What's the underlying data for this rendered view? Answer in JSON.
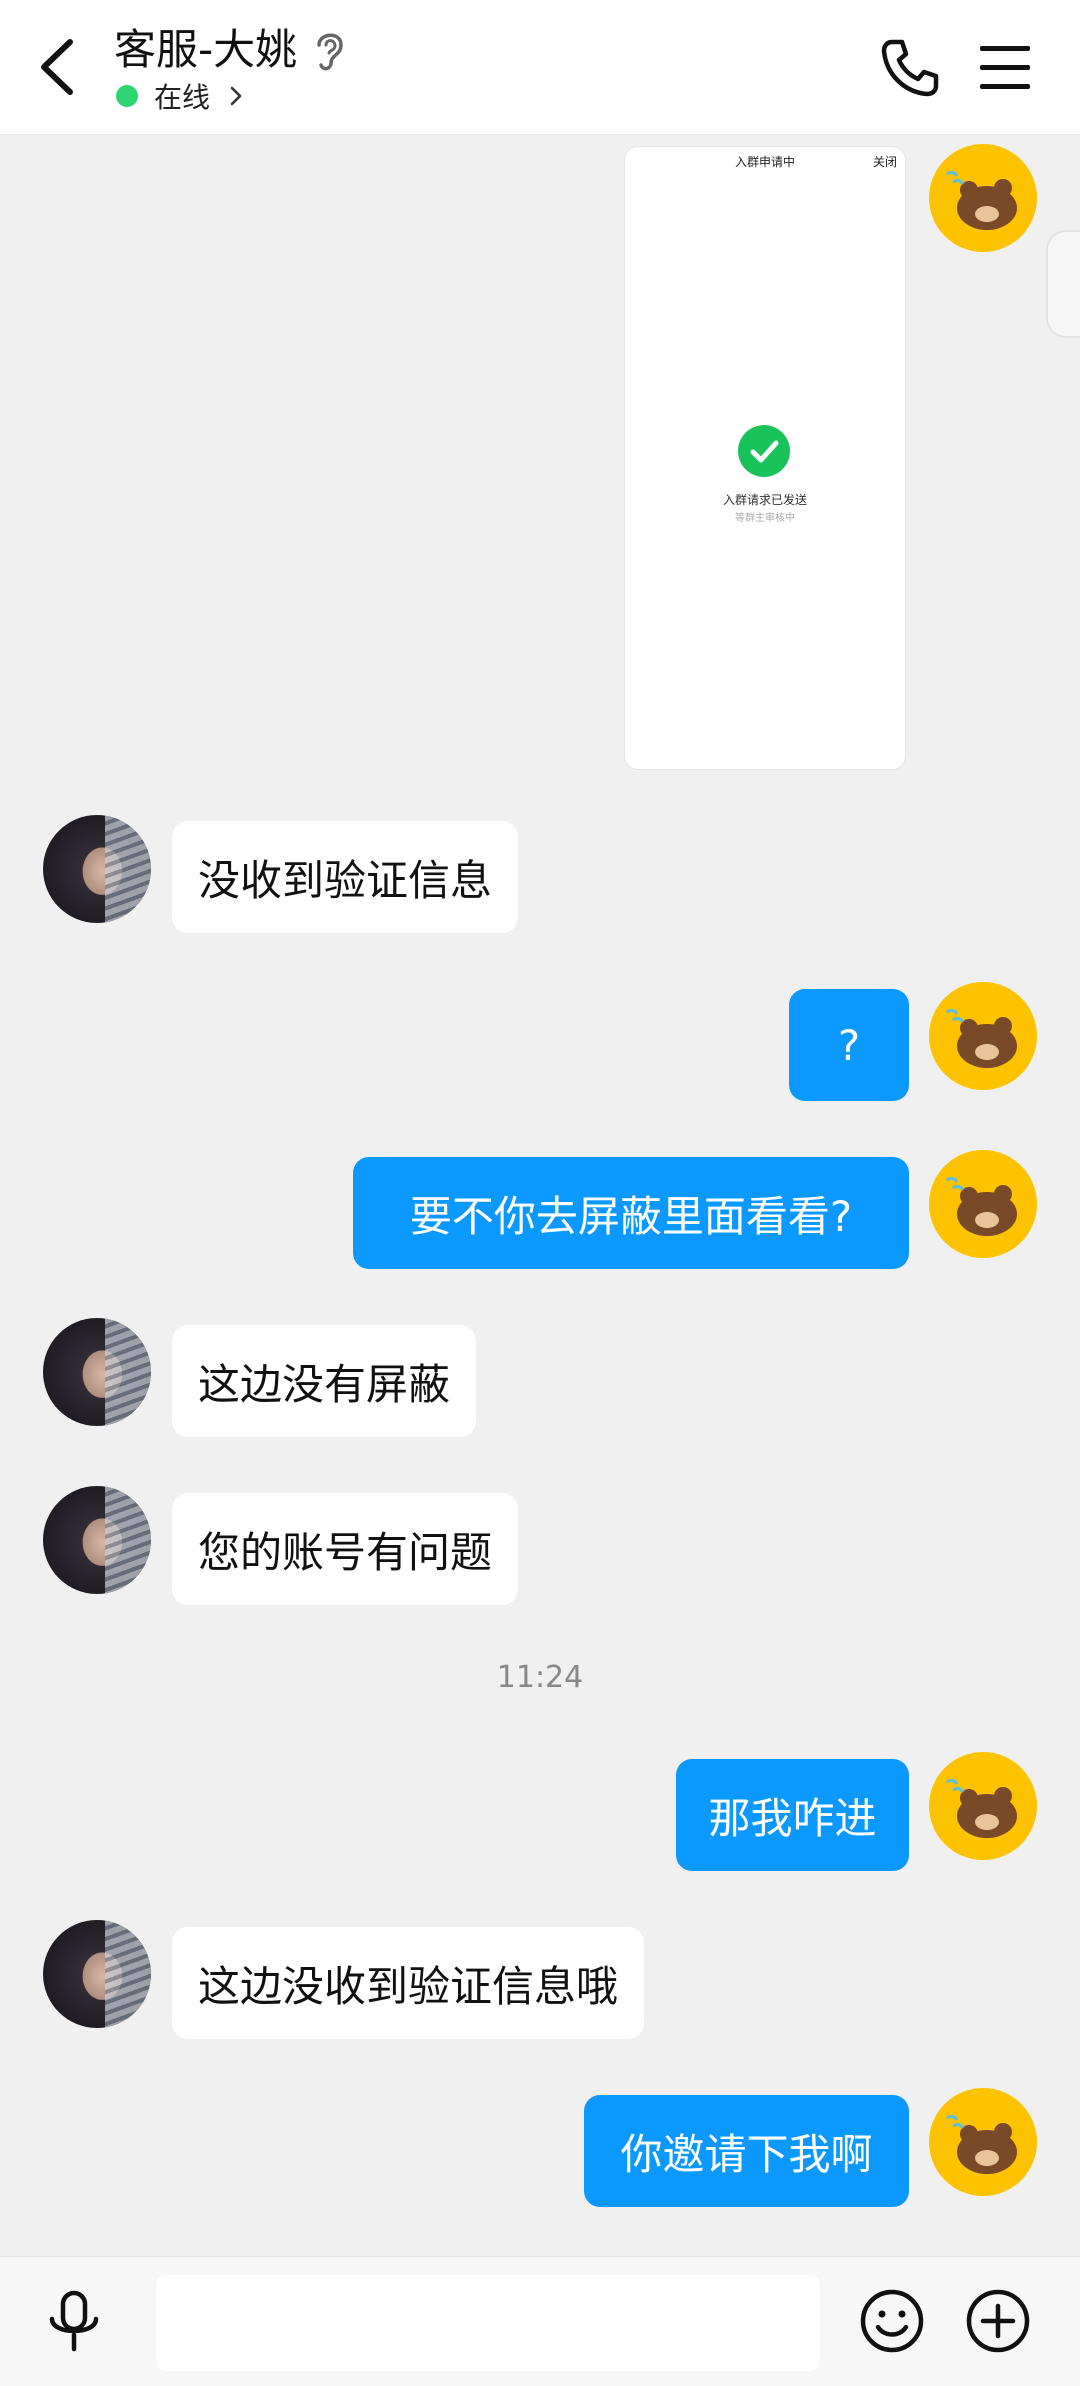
{
  "header": {
    "title": "客服-大姚",
    "status": "在线",
    "icons": [
      "back-arrow-icon",
      "ear-icon",
      "phone-icon",
      "menu-icon"
    ]
  },
  "image_message": {
    "top_text": "入群申请中",
    "close_text": "关闭",
    "line1": "入群请求已发送",
    "line2": "等群主审核中"
  },
  "messages": [
    {
      "side": "in",
      "text": "没收到验证信息"
    },
    {
      "side": "out",
      "text": "?"
    },
    {
      "side": "out",
      "text": "要不你去屏蔽里面看看?"
    },
    {
      "side": "in",
      "text": "这边没有屏蔽"
    },
    {
      "side": "in",
      "text": "您的账号有问题"
    },
    {
      "side": "out",
      "text": "那我咋进"
    },
    {
      "side": "in",
      "text": "这边没收到验证信息哦"
    },
    {
      "side": "out",
      "text": "你邀请下我啊"
    }
  ],
  "timestamp": "11:24",
  "input": {
    "value": "",
    "placeholder": ""
  },
  "colors": {
    "outgoing_bubble": "#0b99ff",
    "incoming_bubble": "#ffffff",
    "online": "#2ed573",
    "background": "#f0f0f0",
    "bear_avatar": "#fdc200"
  }
}
